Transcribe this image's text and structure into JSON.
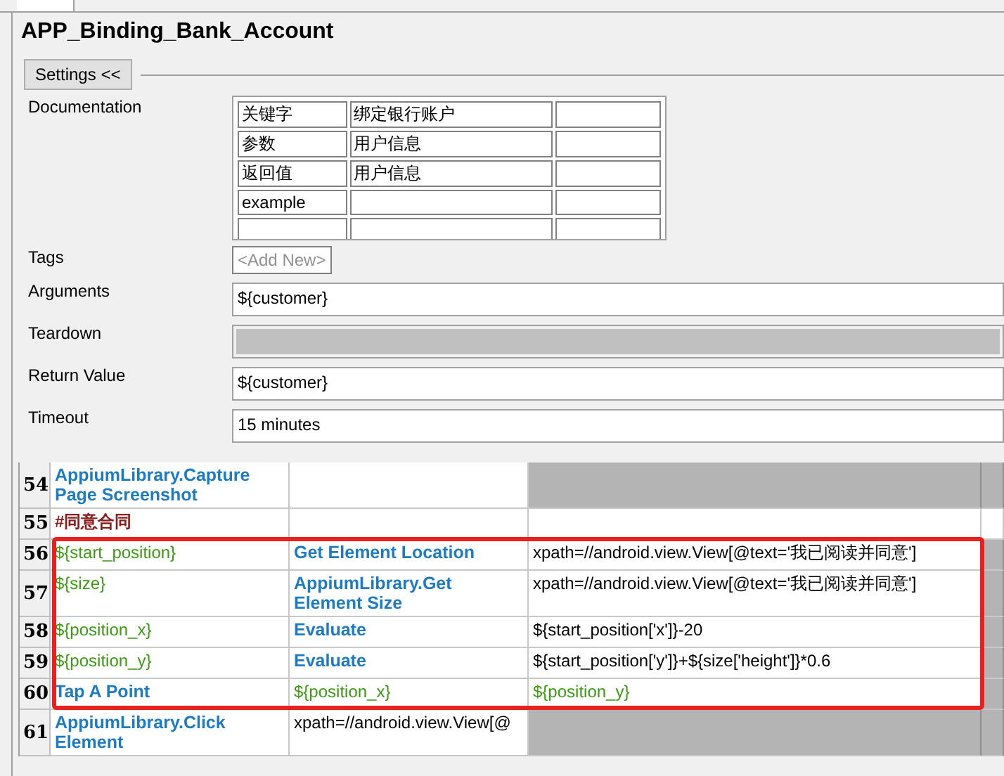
{
  "title": "APP_Binding_Bank_Account",
  "settings_button": "Settings <<",
  "documentation": {
    "label": "Documentation",
    "rows": [
      [
        "关键字",
        "绑定银行账户",
        ""
      ],
      [
        "参数",
        "用户信息",
        ""
      ],
      [
        "返回值",
        "用户信息",
        ""
      ],
      [
        "example",
        "",
        ""
      ],
      [
        "",
        "",
        ""
      ]
    ]
  },
  "tags": {
    "label": "Tags",
    "add_button": "<Add New>"
  },
  "fields": [
    {
      "label": "Arguments",
      "value": "${customer}",
      "disabled": false
    },
    {
      "label": "Teardown",
      "disabled": true
    },
    {
      "label": "Return Value",
      "value": "${customer}",
      "disabled": false
    },
    {
      "label": "Timeout",
      "value": "15 minutes",
      "disabled": false
    }
  ],
  "grid": {
    "rows": [
      {
        "number": "54",
        "cells": [
          {
            "kind": "keyword",
            "text": "AppiumLibrary.Capture Page Screenshot"
          },
          {
            "kind": "plain",
            "text": ""
          },
          {
            "kind": "unused",
            "text": ""
          },
          {
            "kind": "unused",
            "text": ""
          }
        ]
      },
      {
        "number": "55",
        "cells": [
          {
            "kind": "comment",
            "text": "#同意合同"
          },
          {
            "kind": "plain",
            "text": ""
          },
          {
            "kind": "plain",
            "text": ""
          },
          {
            "kind": "plain",
            "text": ""
          }
        ]
      },
      {
        "number": "56",
        "cells": [
          {
            "kind": "variable",
            "text": "${start_position}"
          },
          {
            "kind": "keyword",
            "text": "Get Element Location"
          },
          {
            "kind": "plain",
            "text": "xpath=//android.view.View[@text='我已阅读并同意']"
          },
          {
            "kind": "unused",
            "text": ""
          }
        ]
      },
      {
        "number": "57",
        "cells": [
          {
            "kind": "variable",
            "text": "${size}"
          },
          {
            "kind": "keyword",
            "text": "AppiumLibrary.Get Element Size"
          },
          {
            "kind": "plain",
            "text": "xpath=//android.view.View[@text='我已阅读并同意']"
          },
          {
            "kind": "unused",
            "text": ""
          }
        ]
      },
      {
        "number": "58",
        "cells": [
          {
            "kind": "variable",
            "text": "${position_x}"
          },
          {
            "kind": "keyword",
            "text": "Evaluate"
          },
          {
            "kind": "plain",
            "text": "${start_position['x']}-20"
          },
          {
            "kind": "unused",
            "text": ""
          }
        ]
      },
      {
        "number": "59",
        "cells": [
          {
            "kind": "variable",
            "text": "${position_y}"
          },
          {
            "kind": "keyword",
            "text": "Evaluate"
          },
          {
            "kind": "plain",
            "text": "${start_position['y']}+${size['height']}*0.6"
          },
          {
            "kind": "unused",
            "text": ""
          }
        ]
      },
      {
        "number": "60",
        "cells": [
          {
            "kind": "keyword",
            "text": "Tap A Point"
          },
          {
            "kind": "variable",
            "text": "${position_x}"
          },
          {
            "kind": "variable",
            "text": "${position_y}"
          },
          {
            "kind": "unused",
            "text": ""
          }
        ]
      },
      {
        "number": "61",
        "cells": [
          {
            "kind": "keyword",
            "text": "AppiumLibrary.Click Element"
          },
          {
            "kind": "plain",
            "text": "xpath=//android.view.View[@"
          },
          {
            "kind": "unused",
            "text": ""
          },
          {
            "kind": "unused",
            "text": ""
          }
        ]
      }
    ]
  }
}
